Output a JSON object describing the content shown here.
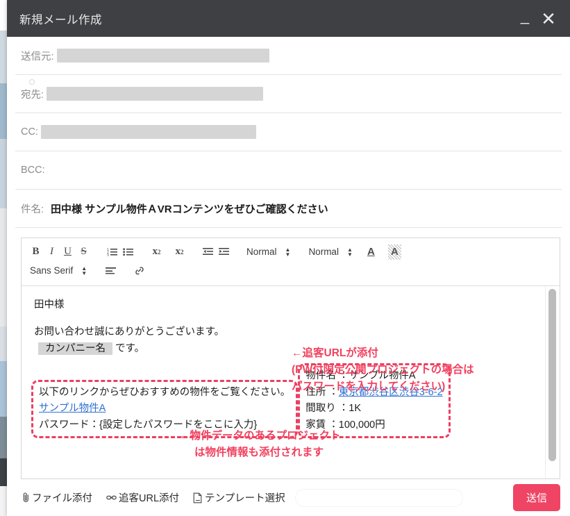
{
  "window": {
    "title": "新規メール作成",
    "minimize_label": "_",
    "close_label": "✕"
  },
  "header_fields": {
    "from": {
      "label": "送信元:",
      "value": "",
      "redacted": true
    },
    "to": {
      "label": "宛先:",
      "value": "",
      "redacted": true
    },
    "cc": {
      "label": "CC:",
      "value": "",
      "redacted": true
    },
    "bcc": {
      "label": "BCC:",
      "value": "",
      "redacted": false
    },
    "subject": {
      "label": "件名:",
      "value": "田中様 サンプル物件ＡVRコンテンツをぜひご確認ください"
    }
  },
  "editor_toolbar": {
    "bold": "B",
    "italic": "I",
    "underline": "U",
    "strikethrough": "S",
    "ordered_list": "ordered-list-icon",
    "bullet_list": "bullet-list-icon",
    "subscript": "x",
    "subscript_index": "2",
    "superscript": "x",
    "superscript_index": "2",
    "outdent": "outdent-icon",
    "indent": "indent-icon",
    "header_select": "Normal",
    "size_select": "Normal",
    "font_color": "A",
    "highlight_color": "A",
    "font_family_select": "Sans Serif",
    "align": "align-icon",
    "link": "link-icon",
    "updown_glyph": "⌃⌄"
  },
  "body": {
    "greeting": "田中様",
    "thanks": "お問い合わせ誠にありがとうございます。",
    "company_token": "カンパニー名",
    "company_suffix": "です。",
    "link_intro": "以下のリンクからぜひおすすめの物件をご覧ください。",
    "property_link": "サンプル物件A",
    "password_line": "パスワード：{設定したパスワードをここに入力}",
    "property_rows": [
      {
        "label": "物件名 ：",
        "value": "サンプル物件A",
        "is_link": false
      },
      {
        "label": "住所 ：",
        "value": "東京都渋谷区渋谷3-6-2",
        "is_link": true
      },
      {
        "label": "間取り ：",
        "value": "1K",
        "is_link": false
      },
      {
        "label": "家賃 ：",
        "value": "100,000円",
        "is_link": false
      }
    ]
  },
  "annotations": {
    "url_note_line1": "←追客URLが添付",
    "url_note_line2": "(PW付限定公開プロジェクトの場合は",
    "url_note_line3": "パスワードを入力してください)",
    "property_note_line1": "←物件データのあるプロジェクト",
    "property_note_line2": "は物件情報も添付されます"
  },
  "bottom_bar": {
    "attach_file": "ファイル添付",
    "attach_url": "追客URL添付",
    "select_template": "テンプレート選択",
    "template_input_value": "",
    "template_input_placeholder": "",
    "send": "送信"
  },
  "colors": {
    "title_bar": "#3f4044",
    "send_button": "#ef4464",
    "annotation_red": "#f2415f",
    "dashed_border": "#ea3f62",
    "link_blue": "#2f6fd0",
    "redacted_gray": "#d5d5d5"
  }
}
